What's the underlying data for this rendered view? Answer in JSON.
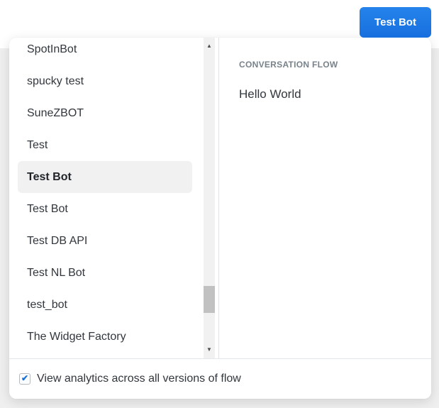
{
  "header": {
    "test_button_label": "Test Bot"
  },
  "bot_list": {
    "items": [
      {
        "label": "SpotInBot",
        "selected": false
      },
      {
        "label": "spucky test",
        "selected": false
      },
      {
        "label": "SuneZBOT",
        "selected": false
      },
      {
        "label": "Test",
        "selected": false
      },
      {
        "label": "Test Bot",
        "selected": true
      },
      {
        "label": "Test Bot",
        "selected": false
      },
      {
        "label": "Test DB API",
        "selected": false
      },
      {
        "label": "Test NL Bot",
        "selected": false
      },
      {
        "label": "test_bot",
        "selected": false
      },
      {
        "label": "The Widget Factory",
        "selected": false
      }
    ]
  },
  "flow_panel": {
    "header": "CONVERSATION FLOW",
    "flows": [
      "Hello World"
    ]
  },
  "footer": {
    "checkbox_checked": true,
    "label": "View analytics across all versions of flow"
  },
  "icons": {
    "scroll_up_icon": "▲",
    "scroll_down_icon": "▼",
    "check_icon": "✔"
  },
  "colors": {
    "accent": "#1d78e5",
    "check_blue": "#1a6fd4",
    "selected_item_bg": "#f1f1f2",
    "scrollbar_thumb": "#c1c1c1",
    "page_bg": "#efefef"
  }
}
